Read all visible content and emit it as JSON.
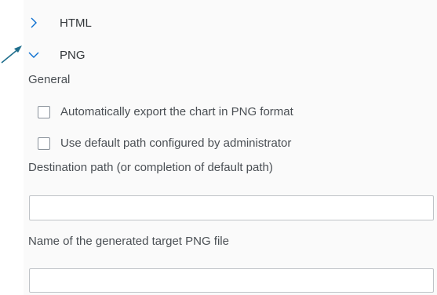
{
  "sections": {
    "html": {
      "label": "HTML",
      "expanded": false
    },
    "png": {
      "label": "PNG",
      "expanded": true
    }
  },
  "general": {
    "heading": "General",
    "auto_export_label": "Automatically export the chart in PNG format",
    "auto_export_checked": false,
    "default_path_label": "Use default path configured by administrator",
    "default_path_checked": false
  },
  "destination": {
    "label": "Destination path (or completion of default path)",
    "value": ""
  },
  "filename": {
    "label": "Name of the generated target PNG file",
    "value": ""
  },
  "colors": {
    "accent": "#0a6ed1",
    "annotation_arrow": "#1f6e8c"
  },
  "icons": {
    "collapsed": "chevron-right-icon",
    "expanded": "chevron-down-icon"
  }
}
